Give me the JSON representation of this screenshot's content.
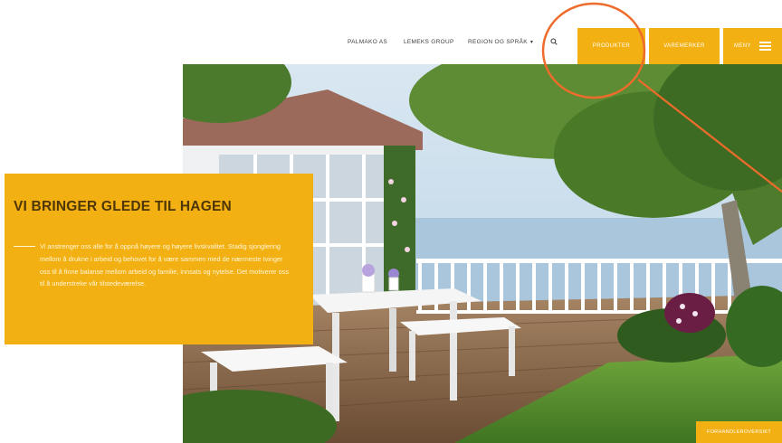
{
  "nav": {
    "links": [
      {
        "label": "PALMAKO AS"
      },
      {
        "label": "LEMEKS GROUP"
      },
      {
        "label": "REGION OG SPRÅK"
      }
    ],
    "search_icon": "search-icon",
    "buttons": {
      "produkter": "PRODUKTER",
      "varemerker": "VAREMERKER",
      "meny": "MENY"
    },
    "menu_icon": "hamburger-icon"
  },
  "hero": {
    "title": "VI BRINGER GLEDE TIL HAGEN",
    "body": "Vi anstrenger oss alle for å oppnå høyere og høyere livskvalitet. Stadig sjonglering mellom å drukne i arbeid og behovet for å være sammen med de nærmeste tvinger oss til å finne balanse mellom arbeid og familie, innsats og nytelse. Det motiverer oss til å understreke vår tilstedeværelse."
  },
  "footer_button": "FORHANDLEROVERSIKT",
  "colors": {
    "accent": "#f3b012",
    "annotation": "#ee6c2b",
    "title_text": "#4e3606"
  }
}
